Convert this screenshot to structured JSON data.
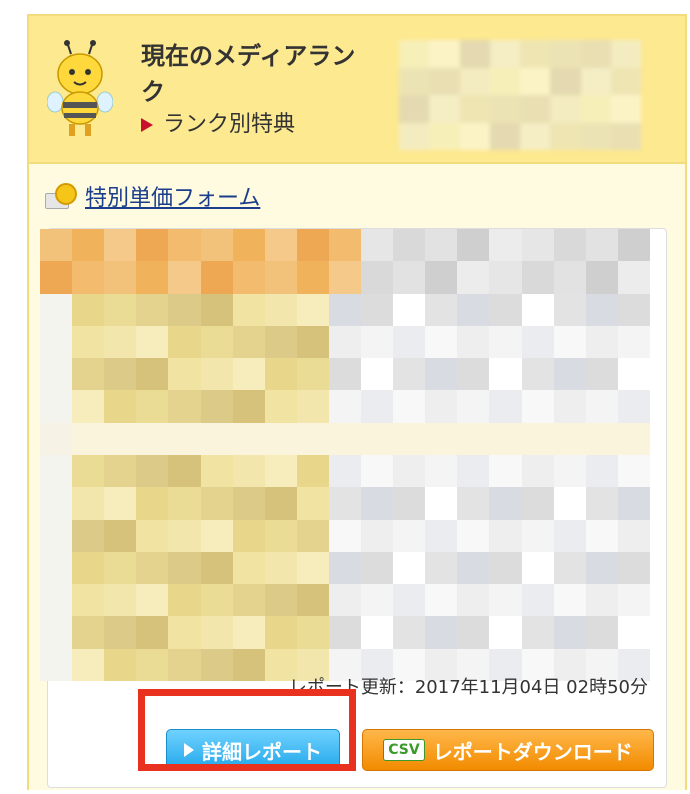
{
  "rank_section": {
    "title": "現在のメディアランク",
    "benefits_link": "ランク別特典",
    "rank_value_hidden": true
  },
  "special_price_form_link": "特別単価フォーム",
  "report": {
    "updated_text": "レポート更新：2017年11月04日 02時50分",
    "detail_button": "詳細レポート",
    "download_button": "レポートダウンロード",
    "csv_badge": "CSV"
  },
  "colors": {
    "header_bg": "#fde98f",
    "panel_bg": "#fffbe1",
    "link_blue": "#1a3e8c",
    "detail_btn": "#22a7ea",
    "download_btn": "#f28b00",
    "highlight_red": "#e8321f"
  }
}
